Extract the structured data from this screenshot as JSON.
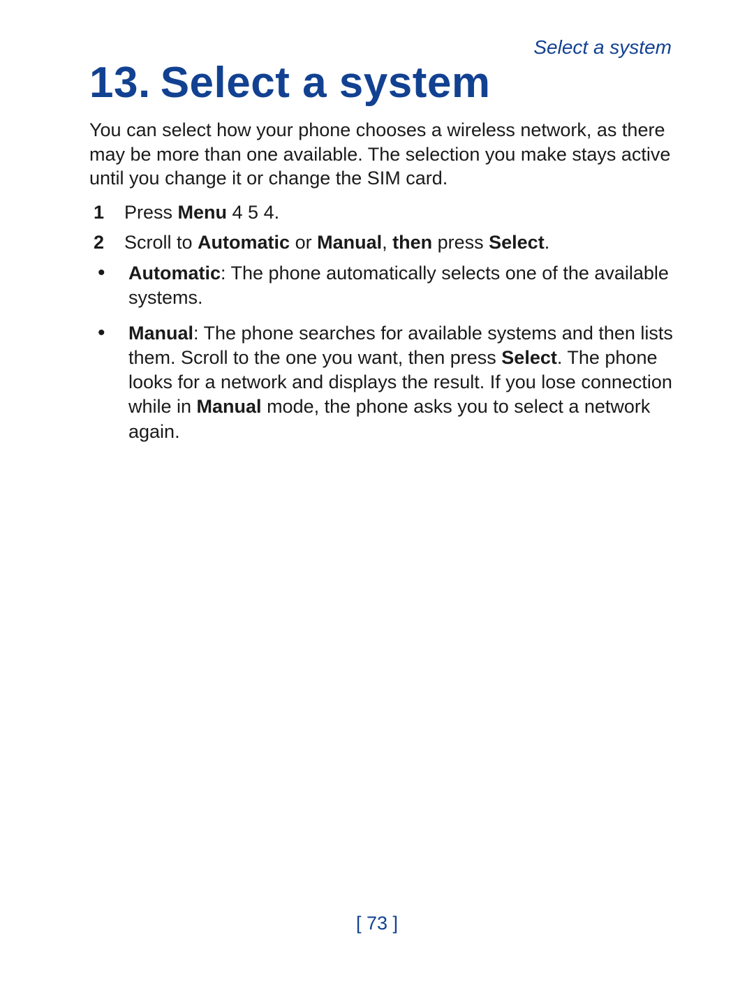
{
  "running_head": "Select a system",
  "chapter": {
    "number": "13.",
    "title": "Select a system"
  },
  "intro": "You can select how your phone chooses a wireless network, as there may be more than one available. The selection you make stays active until you change it or change the SIM card.",
  "step1": {
    "num": "1",
    "t1": "Press ",
    "b1": "Menu",
    "t2": " 4 5 4."
  },
  "step2": {
    "num": "2",
    "t1": "Scroll to ",
    "b1": "Automatic",
    "t2": " or ",
    "b2": "Manual",
    "t3": ", ",
    "b3": "then",
    "t4": " press ",
    "b4": "Select",
    "t5": "."
  },
  "bullet_auto": {
    "b1": "Automatic",
    "t1": ":  The phone automatically selects one of the available systems."
  },
  "bullet_manual": {
    "b1": "Manual",
    "t1": ":  The phone searches for available systems and then lists them. Scroll to the one you want, then press ",
    "b2": "Select",
    "t2": ". The phone looks for a network and displays the result. If you lose connection while in ",
    "b3": "Manual",
    "t3": " mode, the phone asks you to select a network again."
  },
  "page_number": "[ 73 ]"
}
